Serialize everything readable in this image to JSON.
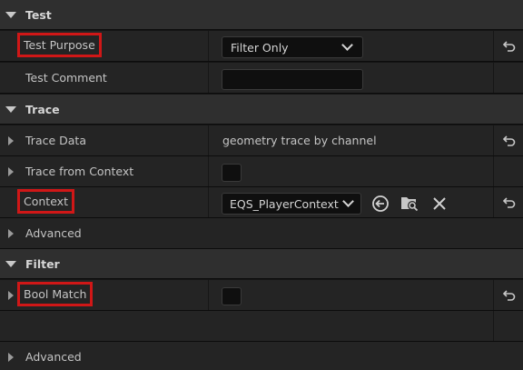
{
  "sections": {
    "test": {
      "title": "Test",
      "test_purpose": {
        "label": "Test Purpose",
        "value": "Filter Only"
      },
      "test_comment": {
        "label": "Test Comment",
        "value": ""
      }
    },
    "trace": {
      "title": "Trace",
      "trace_data": {
        "label": "Trace Data",
        "value": "geometry trace by channel"
      },
      "trace_from_context": {
        "label": "Trace from Context",
        "checked": false
      },
      "context": {
        "label": "Context",
        "value": "EQS_PlayerContext"
      },
      "advanced": {
        "label": "Advanced"
      }
    },
    "filter": {
      "title": "Filter",
      "bool_match": {
        "label": "Bool Match",
        "checked": false
      },
      "advanced": {
        "label": "Advanced"
      }
    }
  },
  "icons": {
    "category_expanded": "triangle-down-icon",
    "collapsed": "triangle-right-icon",
    "reset": "reset-arrow-icon",
    "use_selected": "arrow-left-circle-icon",
    "browse": "folder-search-icon",
    "clear": "close-icon",
    "dropdown": "chevron-down-icon"
  },
  "colors": {
    "highlight": "#d01717",
    "category_bg": "#2f2f2f",
    "row_bg": "#242424"
  }
}
